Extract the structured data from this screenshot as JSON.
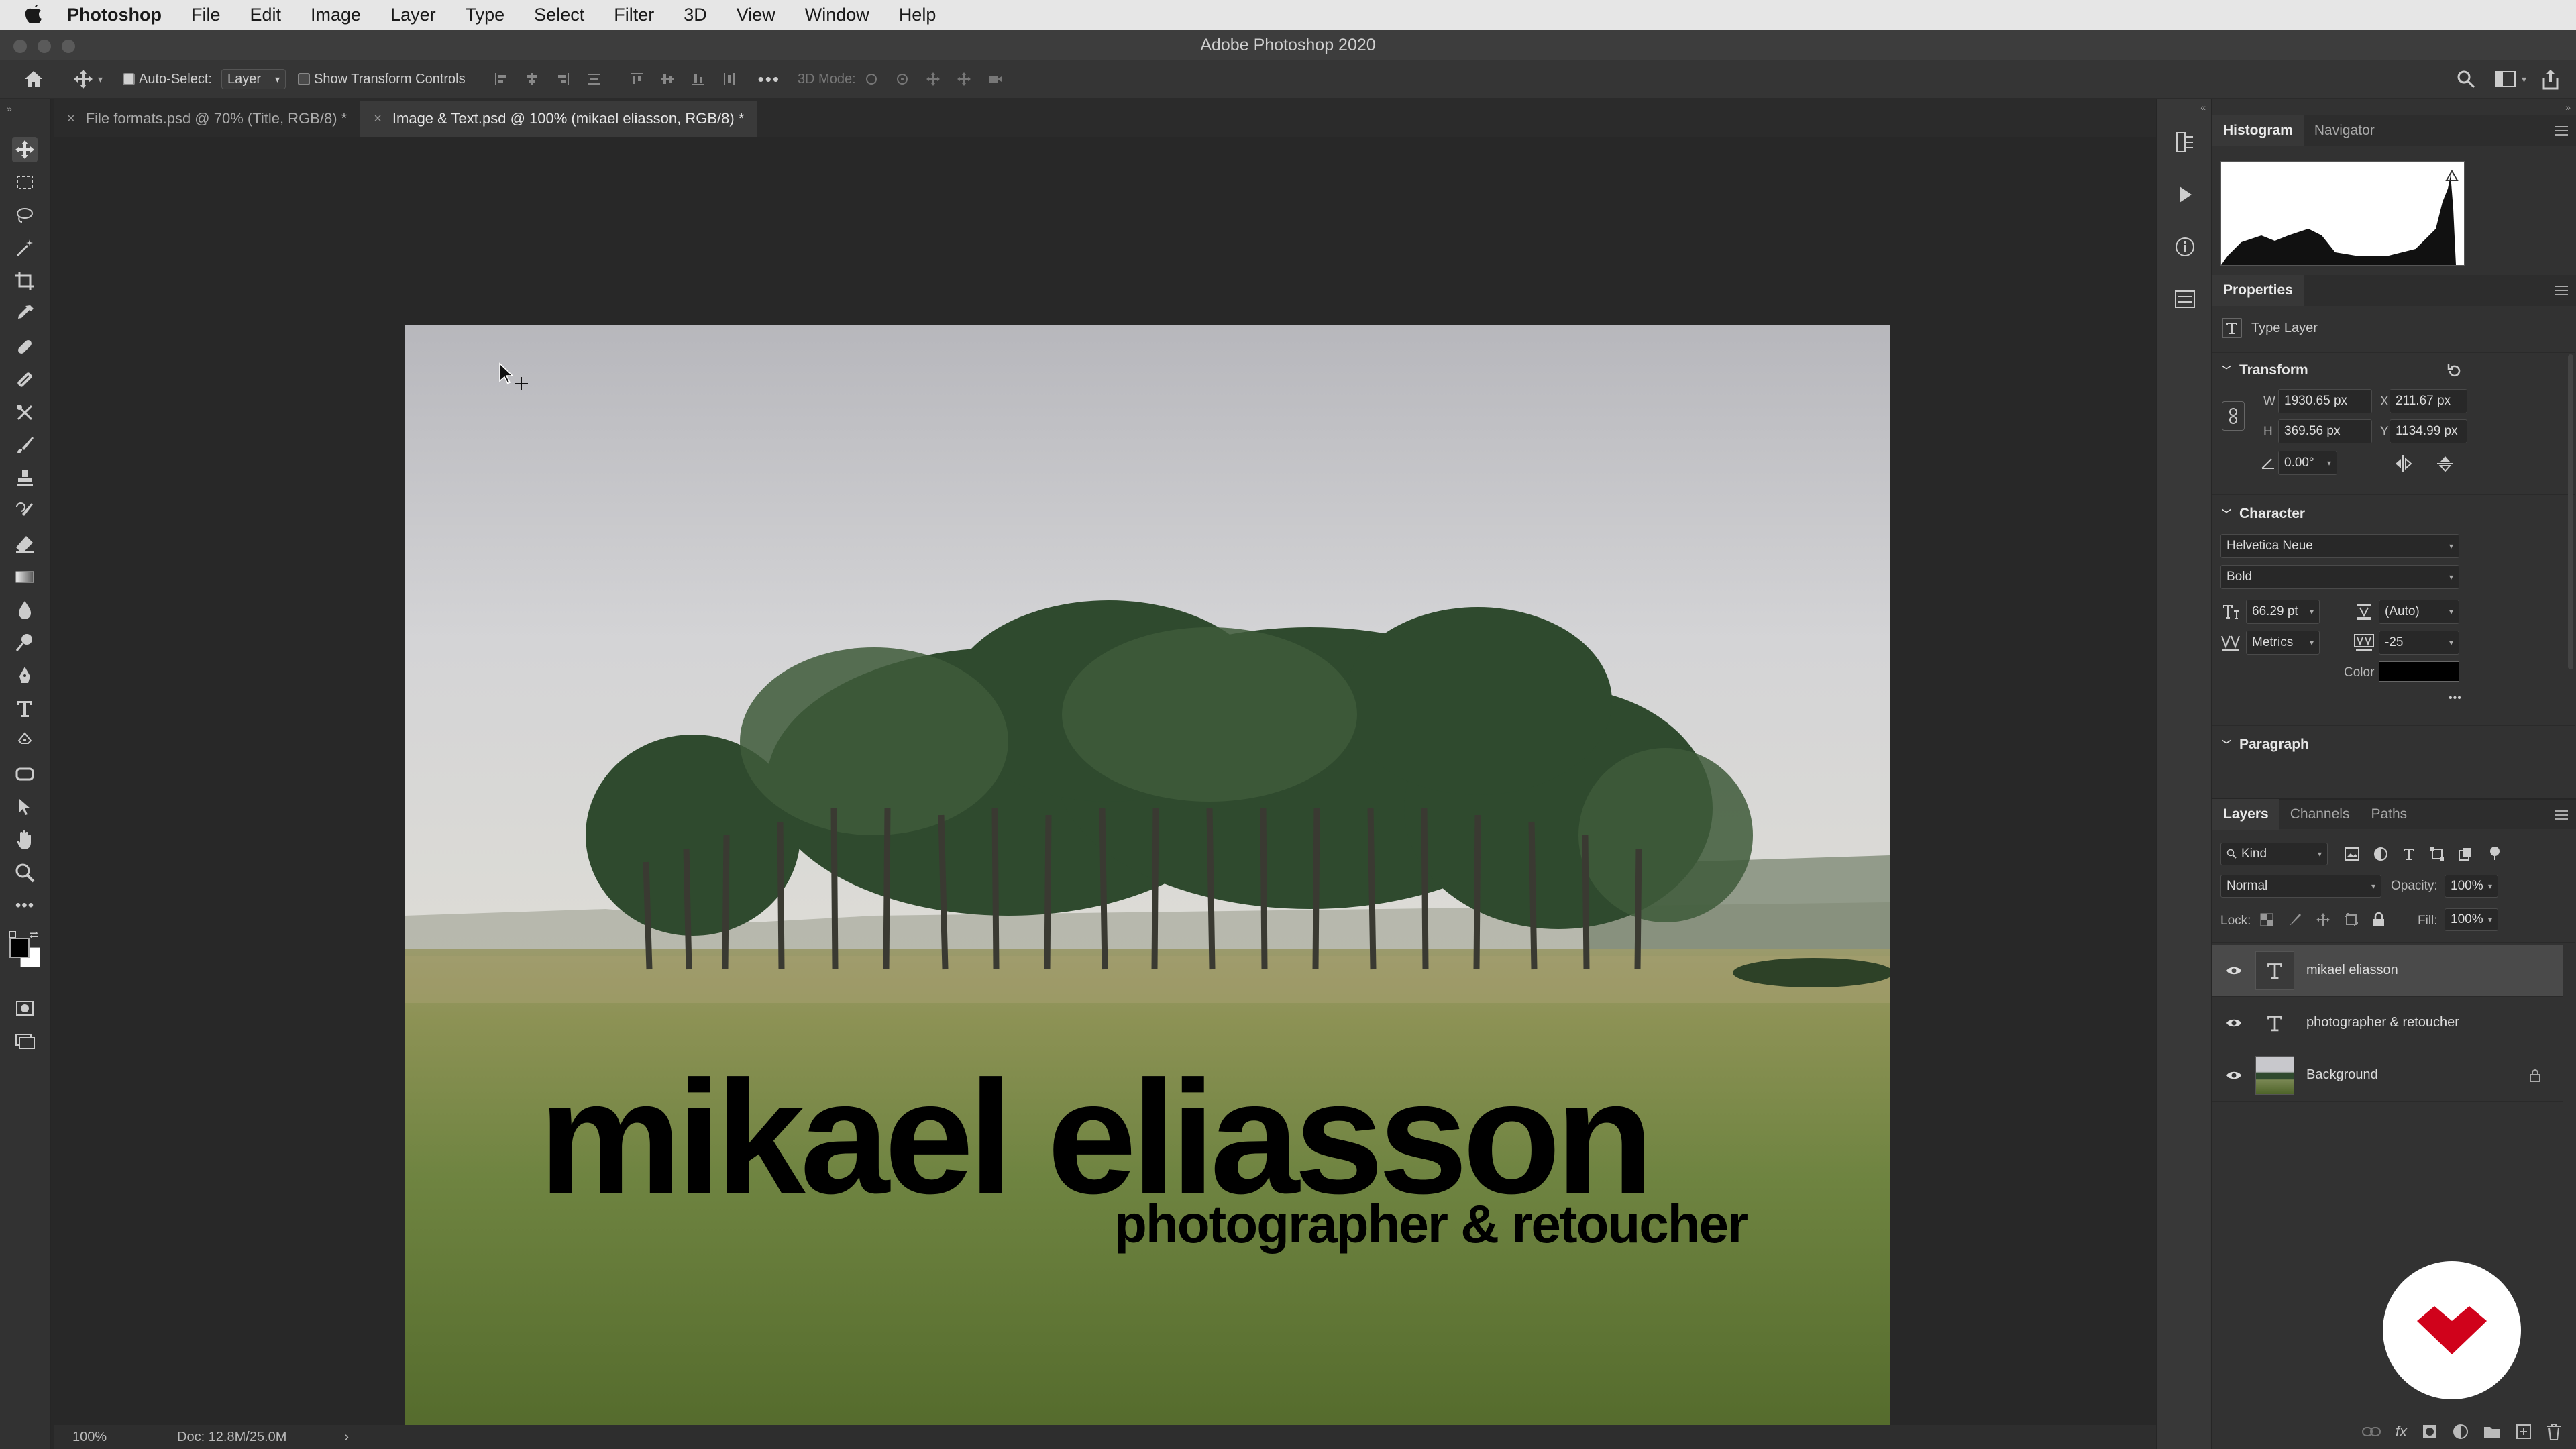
{
  "menubar": {
    "app_name": "Photoshop",
    "items": [
      "File",
      "Edit",
      "Image",
      "Layer",
      "Type",
      "Select",
      "Filter",
      "3D",
      "View",
      "Window",
      "Help"
    ]
  },
  "window": {
    "title": "Adobe Photoshop 2020"
  },
  "options": {
    "auto_select_label": "Auto-Select:",
    "auto_select_value": "Layer",
    "show_transform_label": "Show Transform Controls",
    "mode_3d_label": "3D Mode:"
  },
  "tabs": [
    {
      "label": "File formats.psd @ 70% (Title, RGB/8) *",
      "active": false
    },
    {
      "label": "Image & Text.psd @ 100% (mikael eliasson, RGB/8) *",
      "active": true
    }
  ],
  "document": {
    "headline": "mikael eliasson",
    "subline": "photographer & retoucher"
  },
  "status": {
    "zoom": "100%",
    "doc_size": "Doc: 12.8M/25.0M",
    "arrow": "›"
  },
  "panels": {
    "histogram_tabs": [
      "Histogram",
      "Navigator"
    ],
    "properties_title": "Properties",
    "layer_kind": "Type Layer",
    "transform": {
      "title": "Transform",
      "w_label": "W",
      "w": "1930.65 px",
      "x_label": "X",
      "x": "211.67 px",
      "h_label": "H",
      "h": "369.56 px",
      "y_label": "Y",
      "y": "1134.99 px",
      "angle": "0.00°"
    },
    "character": {
      "title": "Character",
      "font": "Helvetica Neue",
      "style": "Bold",
      "size": "66.29 pt",
      "leading": "(Auto)",
      "kerning": "Metrics",
      "tracking": "-25",
      "color_label": "Color",
      "color": "#000000",
      "more": "•••"
    },
    "paragraph_title": "Paragraph",
    "layers_tabs": [
      "Layers",
      "Channels",
      "Paths"
    ],
    "filter_kind": "Kind",
    "blend_mode": "Normal",
    "opacity_label": "Opacity:",
    "opacity": "100%",
    "lock_label": "Lock:",
    "fill_label": "Fill:",
    "fill": "100%",
    "layers": [
      {
        "name": "mikael eliasson",
        "type": "text",
        "selected": true
      },
      {
        "name": "photographer & retoucher",
        "type": "text",
        "selected": false
      },
      {
        "name": "Background",
        "type": "image",
        "selected": false,
        "locked": true
      }
    ]
  },
  "colors": {
    "accent_red": "#d0021b",
    "foreground": "#000000",
    "background": "#ffffff"
  }
}
